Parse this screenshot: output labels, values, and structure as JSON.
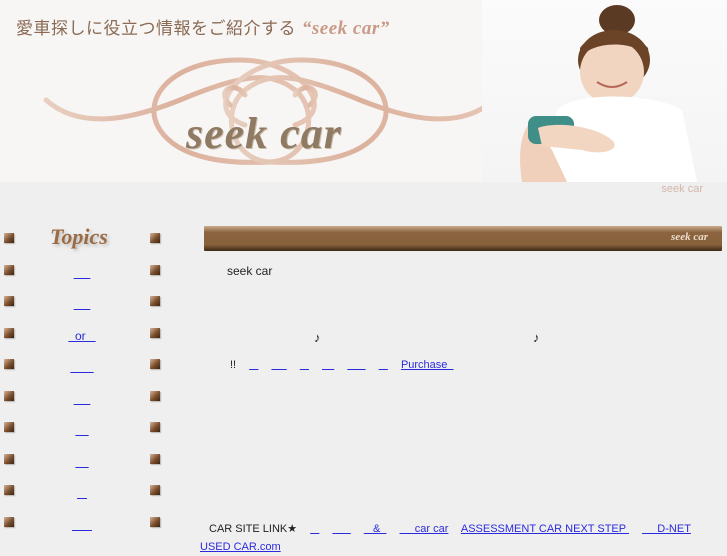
{
  "header": {
    "tagline": "愛車探しに役立つ情報をご紹介する",
    "tagline_brand": "“seek car”",
    "logo_text": "seek car",
    "subtitle": "seek car"
  },
  "sidebar": {
    "title": "Topics",
    "links": [
      {
        "label": "     "
      },
      {
        "label": "     "
      },
      {
        "label": "  or   "
      },
      {
        "label": "       "
      },
      {
        "label": "     "
      },
      {
        "label": "    "
      },
      {
        "label": "    "
      },
      {
        "label": "   "
      },
      {
        "label": "      "
      }
    ]
  },
  "main": {
    "bar_logo": "seek car",
    "title": "seek car",
    "note_left": "♪",
    "note_right": "♪",
    "links_prefix": "!!",
    "links": [
      {
        "label": "   "
      },
      {
        "label": "     "
      },
      {
        "label": "   "
      },
      {
        "label": "    "
      },
      {
        "label": "      "
      },
      {
        "label": "   "
      },
      {
        "label": "Purchase  "
      }
    ]
  },
  "site_links": {
    "label": "CAR SITE LINK★",
    "links": [
      {
        "label": "   "
      },
      {
        "label": "      "
      },
      {
        "label": "   &  "
      },
      {
        "label": "     car car"
      },
      {
        "label": "ASSESSMENT CAR NEXT STEP "
      },
      {
        "label": "     D-NET"
      },
      {
        "label": "USED CAR.com"
      }
    ]
  }
}
